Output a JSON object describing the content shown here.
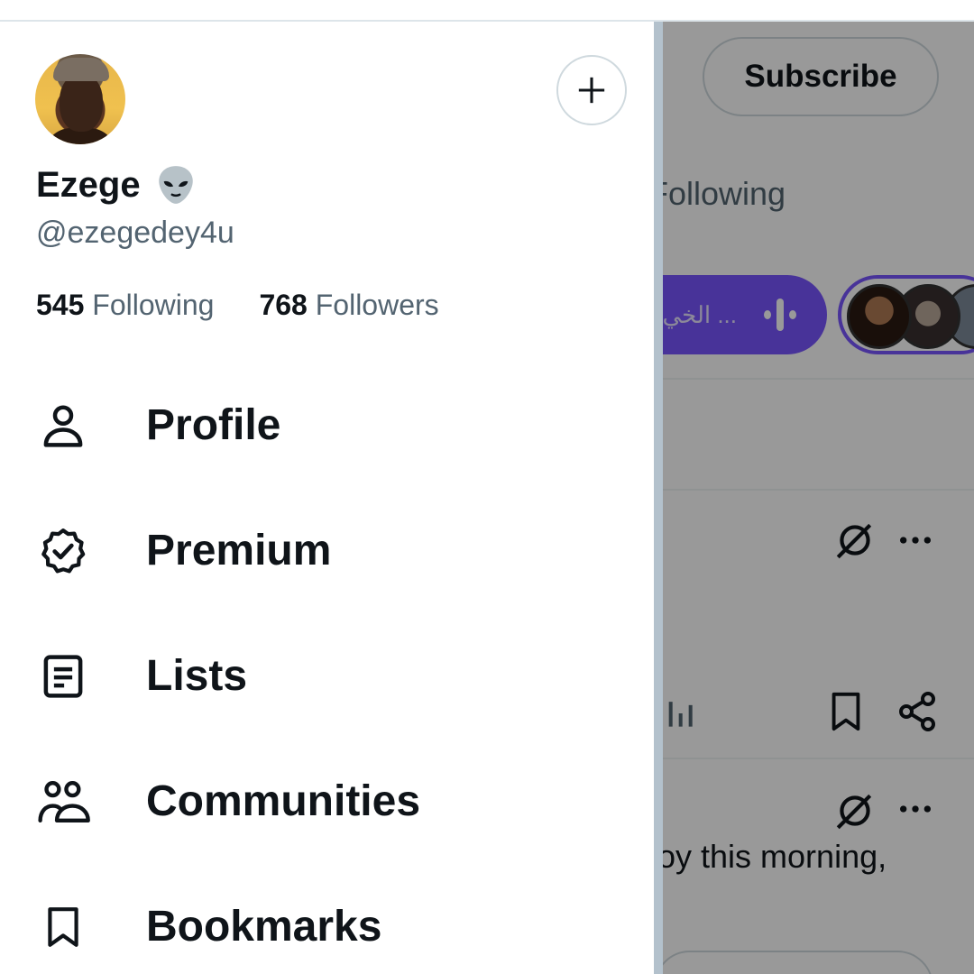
{
  "profile": {
    "display_name": "Ezege",
    "name_emoji": "👽",
    "handle": "@ezegedey4u",
    "following_count": "545",
    "following_label": "Following",
    "followers_count": "768",
    "followers_label": "Followers"
  },
  "drawer": {
    "menu": [
      {
        "label": "Profile",
        "icon": "person-icon"
      },
      {
        "label": "Premium",
        "icon": "verified-badge-icon"
      },
      {
        "label": "Lists",
        "icon": "list-icon"
      },
      {
        "label": "Communities",
        "icon": "communities-icon"
      },
      {
        "label": "Bookmarks",
        "icon": "bookmark-icon"
      }
    ]
  },
  "background": {
    "subscribe_label": "Subscribe",
    "tab_label": "Following",
    "space_title": "... الخي",
    "post_snippet": "oy this morning,"
  },
  "colors": {
    "accent_purple": "#7856ff",
    "text_primary": "#0f1419",
    "text_secondary": "#536471"
  }
}
